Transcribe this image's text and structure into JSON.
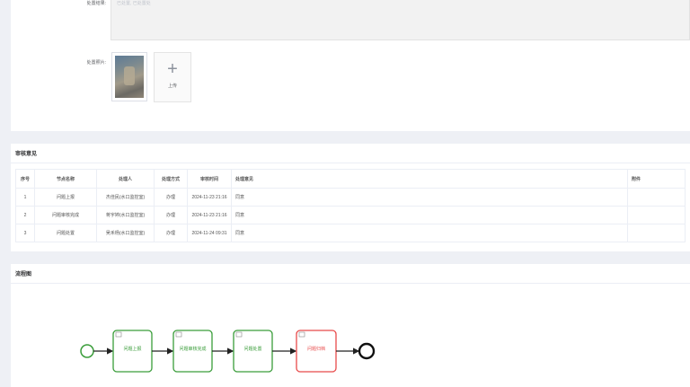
{
  "form": {
    "handle_result_label": "处置结果:",
    "handle_result_placeholder": "已处置, 已处置处",
    "handle_images_label": "处置照片:",
    "upload_label": "上传"
  },
  "review": {
    "title": "审核意见",
    "columns": [
      "序号",
      "节点名称",
      "处理人",
      "处理方式",
      "审核时间",
      "处理意见",
      "附件"
    ],
    "rows": [
      [
        "1",
        "问题上报",
        "杰佳民(水口监控室)",
        "办理",
        "2024-11-23 21:16",
        "同意",
        ""
      ],
      [
        "2",
        "问题审核完成",
        "蒋宇婷(水口监控室)",
        "办理",
        "2024-11-23 21:16",
        "同意",
        ""
      ],
      [
        "3",
        "问题处置",
        "吴禾杨(水口监控室)",
        "办理",
        "2024-11-24 09:31",
        "同意",
        ""
      ]
    ]
  },
  "flow": {
    "title": "流程图",
    "nodes": [
      {
        "label": "问题上报",
        "status": "done",
        "color": "#3a9d3a"
      },
      {
        "label": "问题审核完成",
        "status": "done",
        "color": "#3a9d3a"
      },
      {
        "label": "问题处置",
        "status": "done",
        "color": "#3a9d3a"
      },
      {
        "label": "问题归档",
        "status": "current",
        "color": "#e84a4a"
      }
    ]
  }
}
